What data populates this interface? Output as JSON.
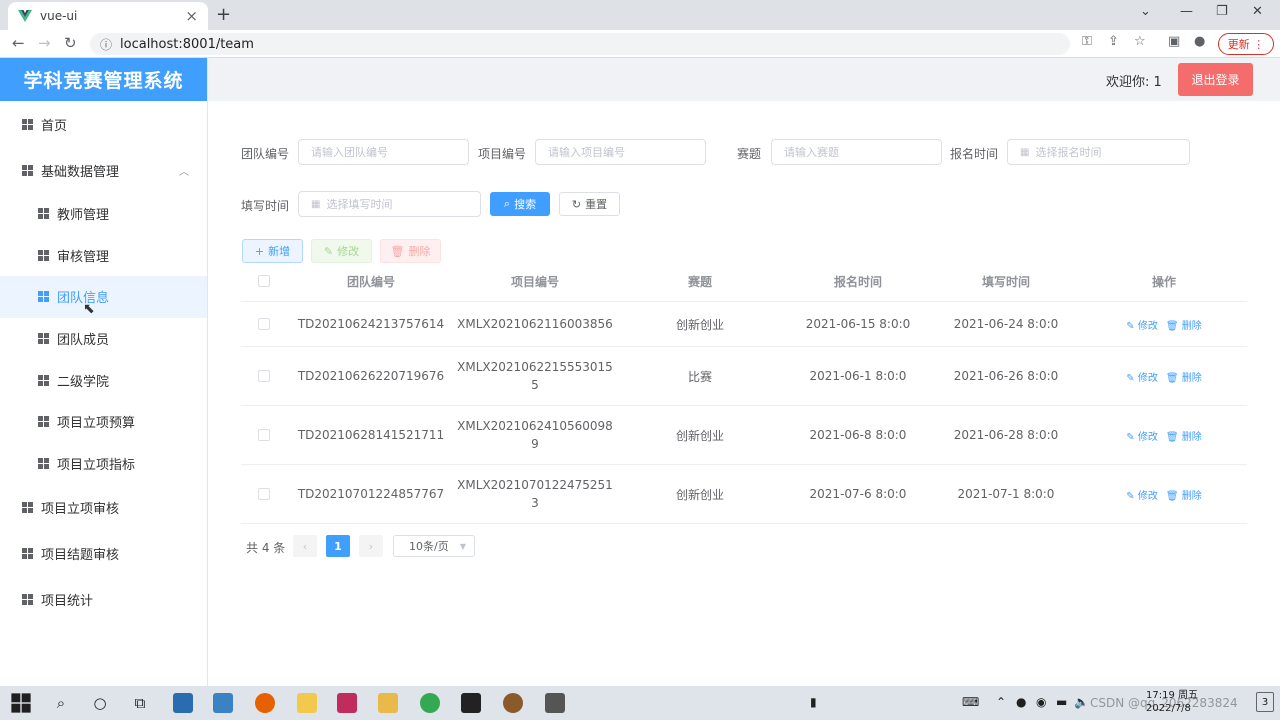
{
  "browser": {
    "tab_title": "vue-ui",
    "url": "localhost:8001/team",
    "update_label": "更新"
  },
  "app": {
    "brand": "学科竞赛管理系统",
    "welcome": "欢迎你: 1",
    "logout": "退出登录"
  },
  "sidebar": {
    "items": [
      {
        "label": "首页"
      },
      {
        "label": "基础数据管理"
      },
      {
        "label": "教师管理"
      },
      {
        "label": "审核管理"
      },
      {
        "label": "团队信息"
      },
      {
        "label": "团队成员"
      },
      {
        "label": "二级学院"
      },
      {
        "label": "项目立项预算"
      },
      {
        "label": "项目立项指标"
      },
      {
        "label": "项目立项审核"
      },
      {
        "label": "项目结题审核"
      },
      {
        "label": "项目统计"
      }
    ]
  },
  "filters": {
    "team_no_label": "团队编号",
    "team_no_placeholder": "请输入团队编号",
    "project_no_label": "项目编号",
    "project_no_placeholder": "请输入项目编号",
    "topic_label": "赛题",
    "topic_placeholder": "请输入赛题",
    "signup_label": "报名时间",
    "signup_placeholder": "选择报名时间",
    "fill_label": "填写时间",
    "fill_placeholder": "选择填写时间",
    "search": "搜索",
    "reset": "重置"
  },
  "toolbar": {
    "add": "新增",
    "edit": "修改",
    "delete": "删除"
  },
  "table": {
    "headers": [
      "团队编号",
      "项目编号",
      "赛题",
      "报名时间",
      "填写时间",
      "操作"
    ],
    "rows": [
      {
        "team_no": "TD20210624213757614",
        "project_l1": "XMLX2021062116003856",
        "project_l2": "",
        "topic": "创新创业",
        "signup": "2021-06-15 8:0:0",
        "fill": "2021-06-24 8:0:0"
      },
      {
        "team_no": "TD20210626220719676",
        "project_l1": "XMLX2021062215553015",
        "project_l2": "5",
        "topic": "比赛",
        "signup": "2021-06-1 8:0:0",
        "fill": "2021-06-26 8:0:0"
      },
      {
        "team_no": "TD20210628141521711",
        "project_l1": "XMLX2021062410560098",
        "project_l2": "9",
        "topic": "创新创业",
        "signup": "2021-06-8 8:0:0",
        "fill": "2021-06-28 8:0:0"
      },
      {
        "team_no": "TD20210701224857767",
        "project_l1": "XMLX2021070122475251",
        "project_l2": "3",
        "topic": "创新创业",
        "signup": "2021-07-6 8:0:0",
        "fill": "2021-07-1 8:0:0"
      }
    ],
    "op_edit": "修改",
    "op_delete": "删除"
  },
  "pagination": {
    "total": "共 4 条",
    "current": "1",
    "page_size": "10条/页"
  },
  "taskbar": {
    "time": "17:19 周五",
    "date": "2022/7/8",
    "watermark": "CSDN @qq_2062283824"
  }
}
